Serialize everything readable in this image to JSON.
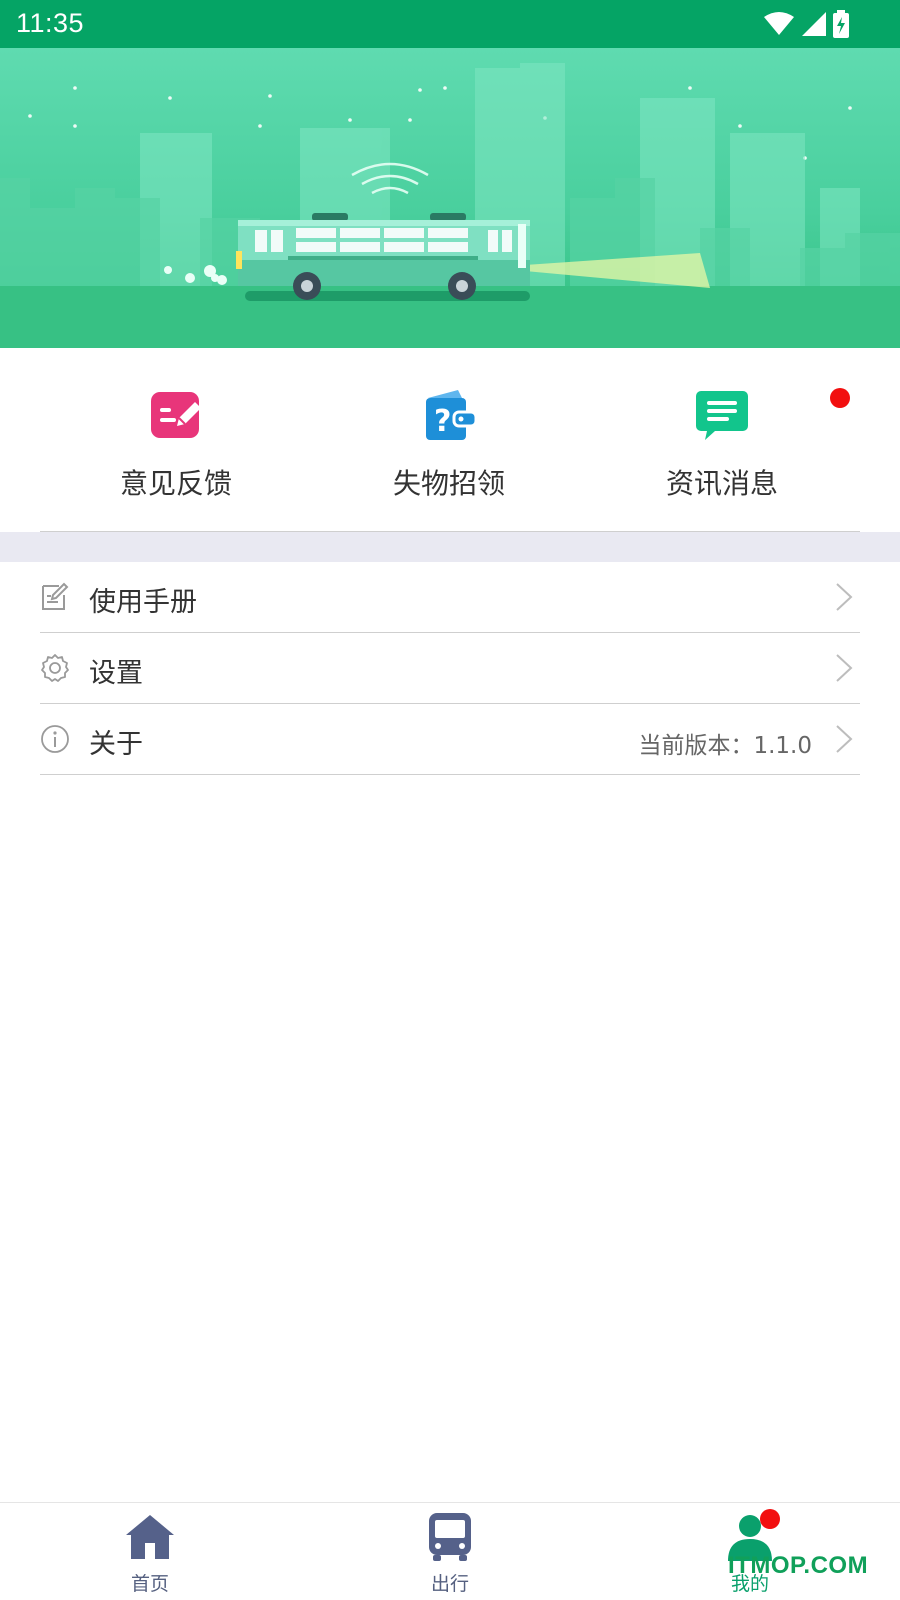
{
  "status_bar": {
    "time": "11:35",
    "icons": [
      "wifi-icon",
      "signal-icon",
      "battery-charging-icon"
    ]
  },
  "quick_actions": [
    {
      "label": "意见反馈",
      "icon": "feedback-edit-icon",
      "color": "#e8357a"
    },
    {
      "label": "失物招领",
      "icon": "lost-found-wallet-icon",
      "color": "#1e8fd8"
    },
    {
      "label": "资讯消息",
      "icon": "news-message-icon",
      "color": "#12c58c",
      "has_badge": true
    }
  ],
  "menu": [
    {
      "label": "使用手册",
      "icon": "manual-icon"
    },
    {
      "label": "设置",
      "icon": "gear-icon"
    },
    {
      "label": "关于",
      "icon": "info-icon",
      "value": "当前版本：1.1.0"
    }
  ],
  "tabbar": {
    "tabs": [
      {
        "label": "首页",
        "icon": "home-icon",
        "active": false
      },
      {
        "label": "出行",
        "icon": "bus-icon",
        "active": false
      },
      {
        "label": "我的",
        "icon": "user-icon",
        "active": true,
        "has_badge": true
      }
    ]
  },
  "watermark": "ITMOP.COM",
  "colors": {
    "brand_green": "#05a465",
    "badge_red": "#f20f0f",
    "divider": "#cfcfcf",
    "section_gap": "#e9e9f2"
  }
}
